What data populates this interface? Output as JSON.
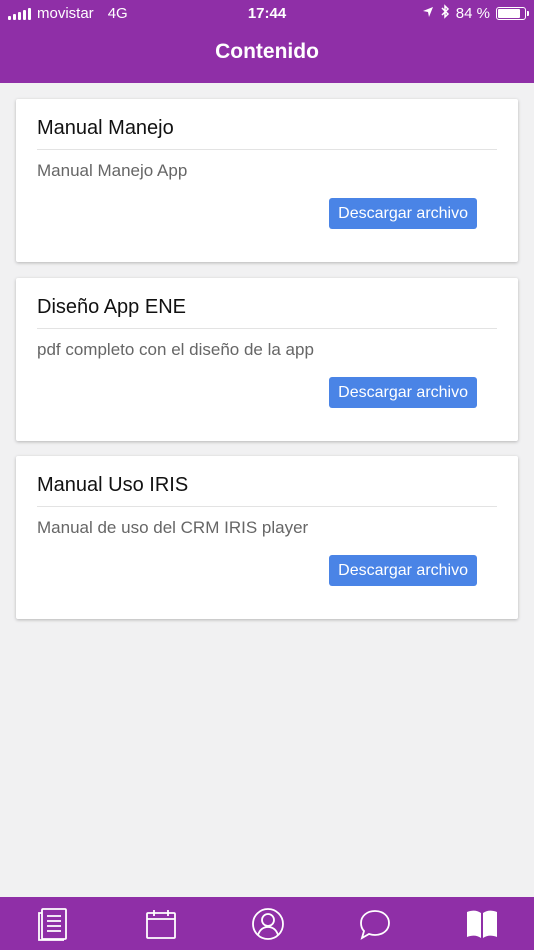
{
  "status_bar": {
    "carrier": "movistar",
    "network": "4G",
    "time": "17:44",
    "battery_percent": "84 %",
    "battery_level": 0.84,
    "icons": [
      "signal-bars-icon",
      "location-arrow-icon",
      "bluetooth-icon",
      "battery-icon"
    ]
  },
  "header": {
    "title": "Contenido"
  },
  "items": [
    {
      "title": "Manual Manejo",
      "description": "Manual Manejo App",
      "button_label": "Descargar archivo"
    },
    {
      "title": "Diseño App ENE",
      "description": "pdf completo con el diseño de la app",
      "button_label": "Descargar archivo"
    },
    {
      "title": "Manual Uso IRIS",
      "description": "Manual de uso del CRM IRIS player",
      "button_label": "Descargar archivo"
    }
  ],
  "tab_bar": {
    "tabs": [
      {
        "icon": "news-icon",
        "active": false
      },
      {
        "icon": "calendar-icon",
        "active": false
      },
      {
        "icon": "profile-icon",
        "active": false
      },
      {
        "icon": "chat-icon",
        "active": false
      },
      {
        "icon": "book-icon",
        "active": true
      }
    ]
  },
  "colors": {
    "brand": "#8f2fa7",
    "button": "#4a84e6",
    "background": "#f1f1f2"
  }
}
